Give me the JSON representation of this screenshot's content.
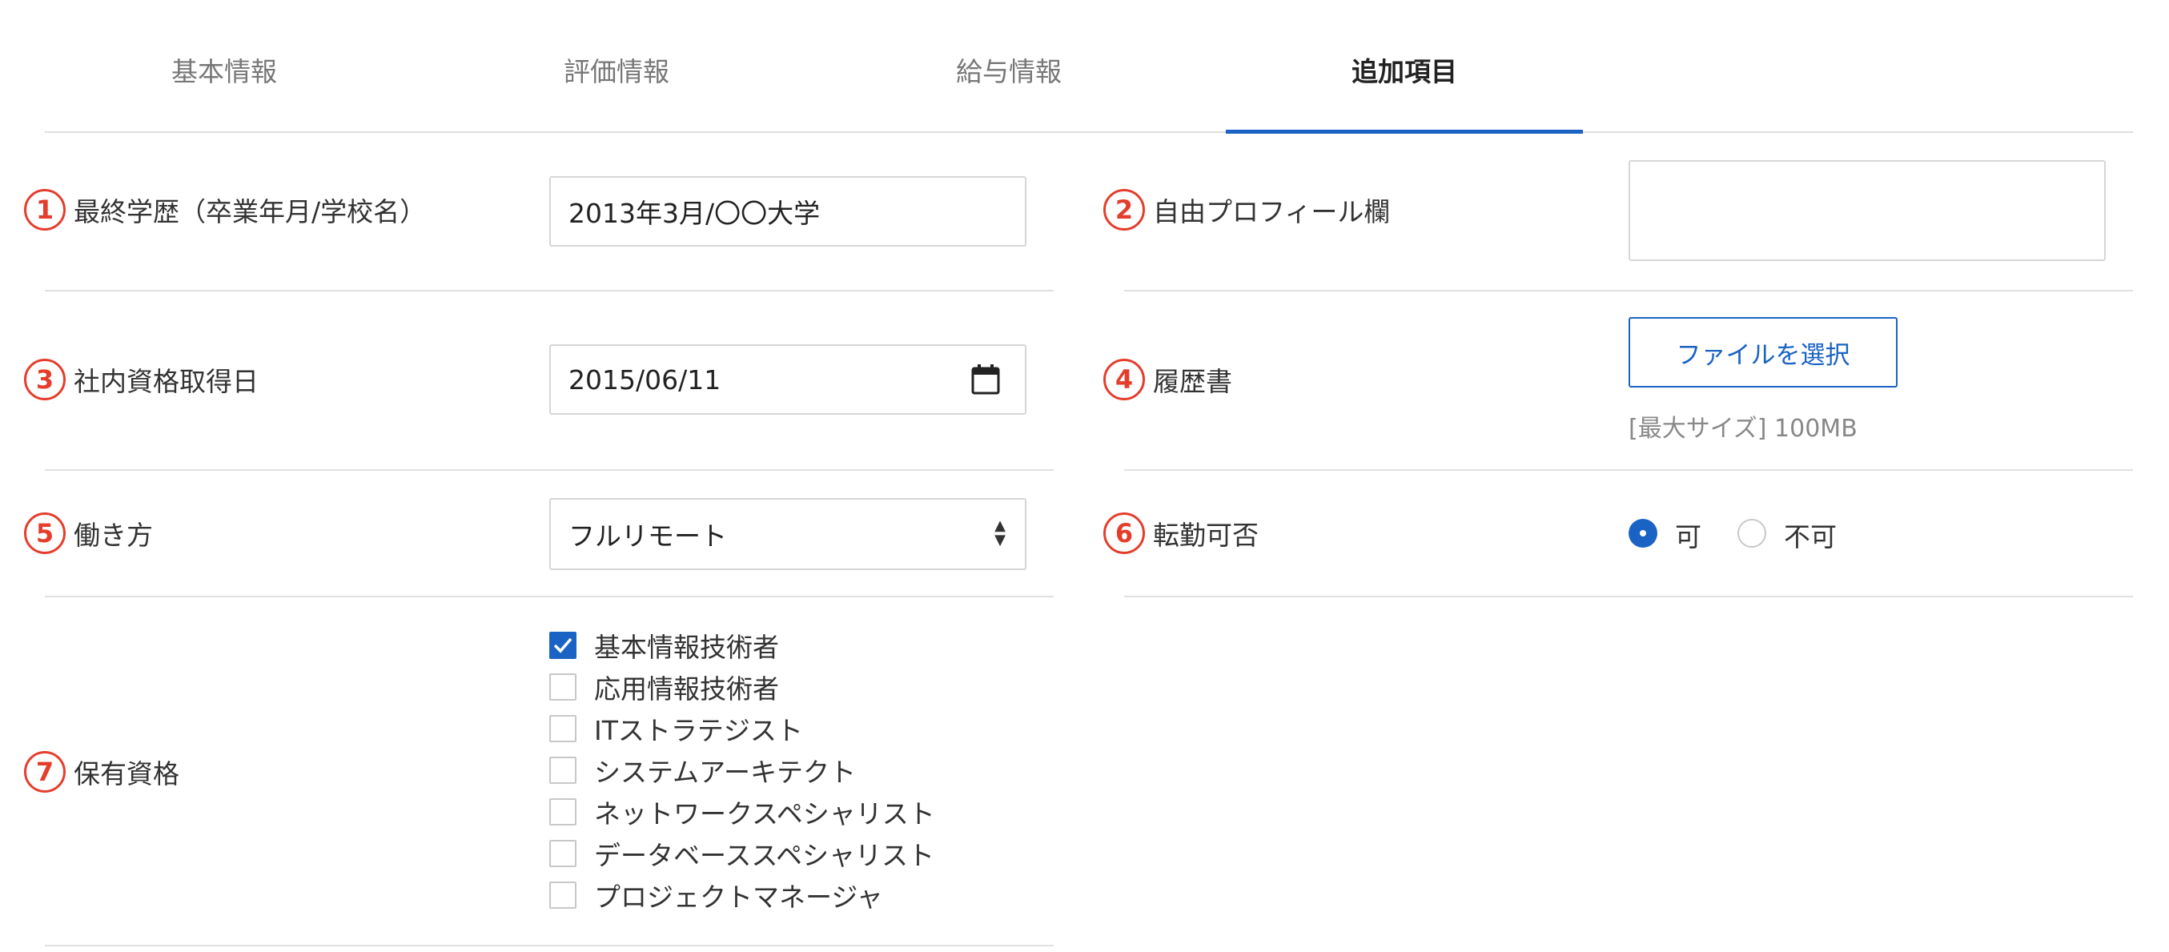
{
  "tabs": [
    {
      "label": "基本情報"
    },
    {
      "label": "評価情報"
    },
    {
      "label": "給与情報"
    },
    {
      "label": "追加項目"
    }
  ],
  "active_tab": "追加項目",
  "fields": {
    "education": {
      "num": "1",
      "label": "最終学歴（卒業年月/学校名）",
      "value": "2013年3月/〇〇大学"
    },
    "profile": {
      "num": "2",
      "label": "自由プロフィール欄",
      "value": ""
    },
    "cert_date": {
      "num": "3",
      "label": "社内資格取得日",
      "value": "2015/06/11",
      "icon": "calendar-icon"
    },
    "resume": {
      "num": "4",
      "label": "履歴書",
      "button": "ファイルを選択",
      "hint": "[最大サイズ] 100MB"
    },
    "work_style": {
      "num": "5",
      "label": "働き方",
      "value": "フルリモート"
    },
    "transfer": {
      "num": "6",
      "label": "転勤可否",
      "options": [
        {
          "label": "可",
          "selected": true
        },
        {
          "label": "不可",
          "selected": false
        }
      ]
    },
    "qualifications": {
      "num": "7",
      "label": "保有資格",
      "options": [
        {
          "label": "基本情報技術者",
          "checked": true
        },
        {
          "label": "応用情報技術者",
          "checked": false
        },
        {
          "label": "ITストラテジスト",
          "checked": false
        },
        {
          "label": "システムアーキテクト",
          "checked": false
        },
        {
          "label": "ネットワークスペシャリスト",
          "checked": false
        },
        {
          "label": "データベーススペシャリスト",
          "checked": false
        },
        {
          "label": "プロジェクトマネージャ",
          "checked": false
        }
      ]
    }
  },
  "colors": {
    "accent": "#1a63c4",
    "number_badge": "#e53d2c"
  }
}
